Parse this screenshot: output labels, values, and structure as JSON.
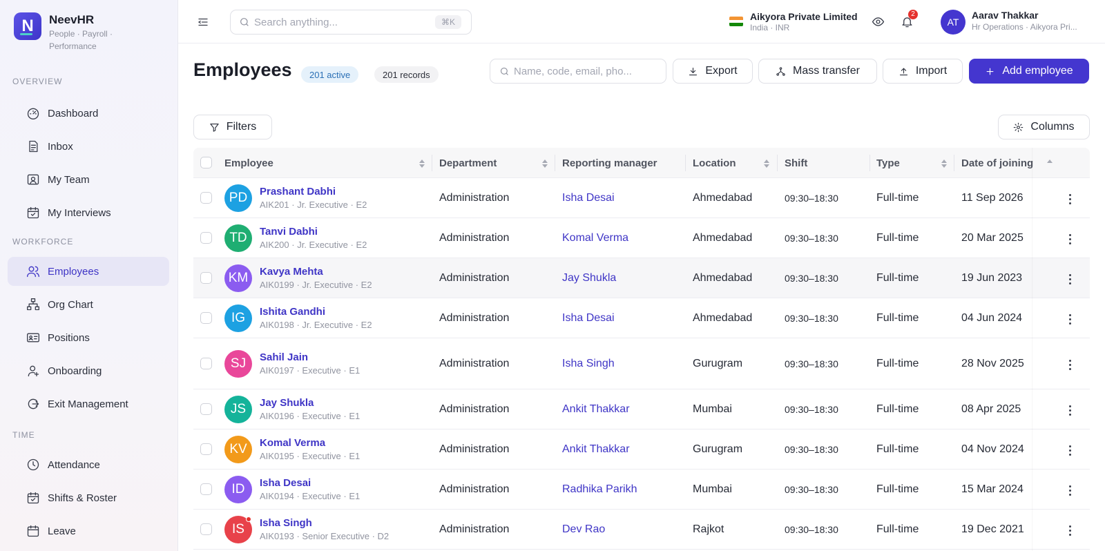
{
  "brand": {
    "name": "NeevHR",
    "logo_letter": "N",
    "tagline": "People · Payroll · Performance"
  },
  "sidebar": {
    "sections": [
      {
        "label": "OVERVIEW"
      },
      {
        "label": "WORKFORCE"
      },
      {
        "label": "TIME"
      }
    ],
    "items": [
      {
        "label": "Dashboard",
        "icon": "gauge-icon"
      },
      {
        "label": "Inbox",
        "icon": "inbox-icon"
      },
      {
        "label": "My Team",
        "icon": "team-icon"
      },
      {
        "label": "My Interviews",
        "icon": "calendar-check-icon"
      },
      {
        "label": "Employees",
        "icon": "users-icon",
        "active": true
      },
      {
        "label": "Org Chart",
        "icon": "org-chart-icon"
      },
      {
        "label": "Positions",
        "icon": "id-card-icon"
      },
      {
        "label": "Onboarding",
        "icon": "user-plus-icon"
      },
      {
        "label": "Exit Management",
        "icon": "exit-icon"
      },
      {
        "label": "Attendance",
        "icon": "clock-icon"
      },
      {
        "label": "Shifts & Roster",
        "icon": "calendar-check-icon"
      },
      {
        "label": "Leave",
        "icon": "calendar-icon"
      }
    ]
  },
  "topbar": {
    "search_placeholder": "Search anything...",
    "search_shortcut": "⌘K",
    "company": {
      "name": "Aikyora Private Limited",
      "sub": "India · INR"
    },
    "notifications_count": "2",
    "user": {
      "initials": "AT",
      "name": "Aarav Thakkar",
      "role": "Hr Operations · Aikyora Pri..."
    }
  },
  "page": {
    "title": "Employees",
    "active_badge": "201 active",
    "records_badge": "201 records",
    "search_placeholder": "Name, code, email, pho...",
    "buttons": {
      "export": "Export",
      "mass_transfer": "Mass transfer",
      "import": "Import",
      "add_employee": "Add employee",
      "filters": "Filters",
      "columns": "Columns"
    }
  },
  "table": {
    "columns": [
      "Employee",
      "Department",
      "Reporting manager",
      "Location",
      "Shift",
      "Type",
      "Date of joining"
    ],
    "rows": [
      {
        "initials": "PD",
        "color": "#1da1e2",
        "name": "Prashant Dabhi",
        "meta": "AIK201 · Jr. Executive · E2",
        "department": "Administration",
        "manager": "Isha Desai",
        "location": "Ahmedabad",
        "shift": "09:30–18:30",
        "type": "Full-time",
        "doj": "11 Sep 2026"
      },
      {
        "initials": "TD",
        "color": "#1fae72",
        "name": "Tanvi Dabhi",
        "meta": "AIK200 · Jr. Executive · E2",
        "department": "Administration",
        "manager": "Komal Verma",
        "location": "Ahmedabad",
        "shift": "09:30–18:30",
        "type": "Full-time",
        "doj": "20 Mar 2025"
      },
      {
        "initials": "KM",
        "color": "#8b5cf0",
        "name": "Kavya Mehta",
        "meta": "AIK0199 · Jr. Executive · E2",
        "department": "Administration",
        "manager": "Jay Shukla",
        "location": "Ahmedabad",
        "shift": "09:30–18:30",
        "type": "Full-time",
        "doj": "19 Jun 2023"
      },
      {
        "initials": "IG",
        "color": "#1da1e2",
        "name": "Ishita Gandhi",
        "meta": "AIK0198 · Jr. Executive · E2",
        "department": "Administration",
        "manager": "Isha Desai",
        "location": "Ahmedabad",
        "shift": "09:30–18:30",
        "type": "Full-time",
        "doj": "04 Jun 2024"
      },
      {
        "initials": "SJ",
        "color": "#e9479a",
        "name": "Sahil Jain",
        "meta": "AIK0197 · Executive · E1",
        "department": "Administration",
        "manager": "Isha Singh",
        "location": "Gurugram",
        "shift": "09:30–18:30",
        "type": "Full-time",
        "doj": "28 Nov 2025"
      },
      {
        "initials": "JS",
        "color": "#14b39a",
        "name": "Jay Shukla",
        "meta": "AIK0196 · Executive · E1",
        "department": "Administration",
        "manager": "Ankit Thakkar",
        "location": "Mumbai",
        "shift": "09:30–18:30",
        "type": "Full-time",
        "doj": "08 Apr 2025"
      },
      {
        "initials": "KV",
        "color": "#f29a1a",
        "name": "Komal Verma",
        "meta": "AIK0195 · Executive · E1",
        "department": "Administration",
        "manager": "Ankit Thakkar",
        "location": "Gurugram",
        "shift": "09:30–18:30",
        "type": "Full-time",
        "doj": "04 Nov 2024"
      },
      {
        "initials": "ID",
        "color": "#8b5cf0",
        "name": "Isha Desai",
        "meta": "AIK0194 · Executive · E1",
        "department": "Administration",
        "manager": "Radhika Parikh",
        "location": "Mumbai",
        "shift": "09:30–18:30",
        "type": "Full-time",
        "doj": "15 Mar 2024"
      },
      {
        "initials": "IS",
        "color": "#e8424a",
        "name": "Isha Singh",
        "meta": "AIK0193 · Senior Executive · D2",
        "department": "Administration",
        "manager": "Dev Rao",
        "location": "Rajkot",
        "shift": "09:30–18:30",
        "type": "Full-time",
        "doj": "19 Dec 2021",
        "alert": true
      }
    ]
  }
}
